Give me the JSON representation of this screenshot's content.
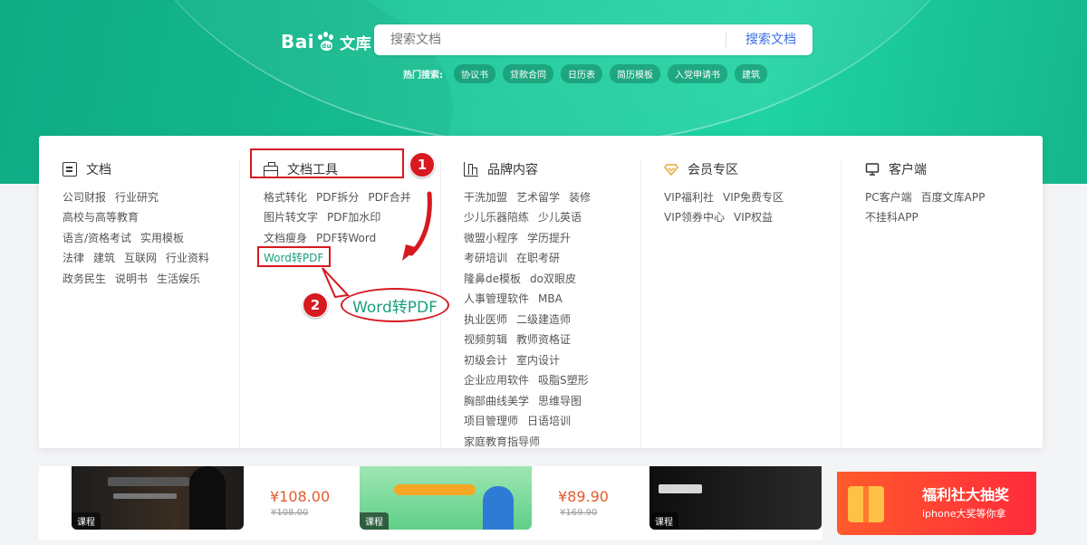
{
  "header": {
    "logo_text_a": "Bai",
    "logo_text_du": "du",
    "logo_text_wenku": "文库",
    "search_placeholder": "搜索文档",
    "search_button": "搜索文档",
    "hot_label": "热门搜索:",
    "hot_tags": [
      "协议书",
      "贷款合同",
      "日历表",
      "简历模板",
      "入党申请书",
      "建筑"
    ]
  },
  "menu": {
    "columns": [
      {
        "title": "文档",
        "icon": "document-icon",
        "lines": [
          [
            "公司财报",
            "行业研究"
          ],
          [
            "高校与高等教育"
          ],
          [
            "语言/资格考试",
            "实用模板"
          ],
          [
            "法律",
            "建筑",
            "互联网",
            "行业资料"
          ],
          [
            "政务民生",
            "说明书",
            "生活娱乐"
          ]
        ]
      },
      {
        "title": "文档工具",
        "icon": "toolbox-icon",
        "lines": [
          [
            "格式转化",
            "PDF拆分",
            "PDF合并"
          ],
          [
            "图片转文字",
            "PDF加水印"
          ],
          [
            "文档瘦身",
            "PDF转Word"
          ],
          [
            "Word转PDF"
          ]
        ]
      },
      {
        "title": "品牌内容",
        "icon": "brand-building-icon",
        "lines": [
          [
            "干洗加盟",
            "艺术留学",
            "装修"
          ],
          [
            "少儿乐器陪练",
            "少儿英语"
          ],
          [
            "微盟小程序",
            "学历提升"
          ],
          [
            "考研培训",
            "在职考研"
          ],
          [
            "隆鼻de模板",
            "do双眼皮"
          ],
          [
            "人事管理软件",
            "MBA"
          ],
          [
            "执业医师",
            "二级建造师"
          ],
          [
            "视频剪辑",
            "教师资格证"
          ],
          [
            "初级会计",
            "室内设计"
          ],
          [
            "企业应用软件",
            "吸脂S塑形"
          ],
          [
            "胸部曲线美学",
            "思维导图"
          ],
          [
            "项目管理师",
            "日语培训"
          ],
          [
            "家庭教育指导师"
          ]
        ]
      },
      {
        "title": "会员专区",
        "icon": "vip-diamond-icon",
        "lines": [
          [
            "VIP福利社",
            "VIP免费专区"
          ],
          [
            "VIP领券中心",
            "VIP权益"
          ]
        ]
      },
      {
        "title": "客户端",
        "icon": "monitor-icon",
        "lines": [
          [
            "PC客户端",
            "百度文库APP"
          ],
          [
            "不挂科APP"
          ]
        ]
      }
    ]
  },
  "annotations": {
    "step1": "1",
    "step2": "2",
    "bubble_text": "Word转PDF"
  },
  "strip": {
    "course_label": "课程",
    "price1": "¥108.00",
    "old1": "¥108.00",
    "price2": "¥89.90",
    "old2": "¥169.90",
    "promo_title": "福利社大抽奖",
    "promo_sub": "iphone大奖等你拿"
  },
  "colors": {
    "brand_green": "#19c99a",
    "annotation_red": "#d71920",
    "link_blue": "#3a6ee8",
    "price_orange": "#e35b2c"
  }
}
